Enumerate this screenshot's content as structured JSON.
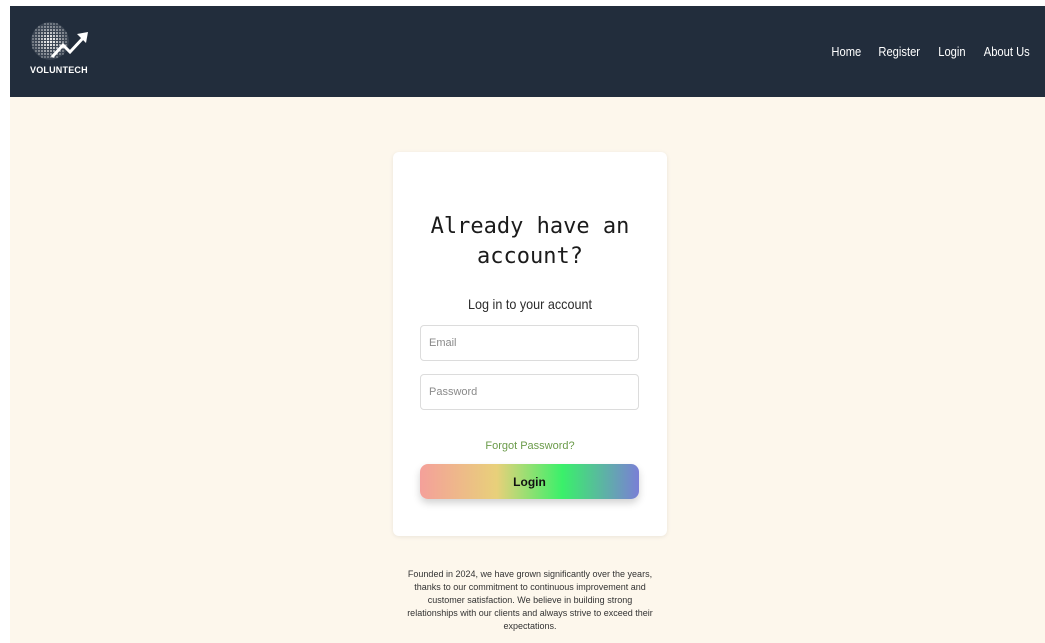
{
  "navbar": {
    "logo_text": "VOLUNTECH",
    "links": [
      {
        "label": "Home"
      },
      {
        "label": "Register"
      },
      {
        "label": "Login"
      },
      {
        "label": "About Us"
      }
    ]
  },
  "login_card": {
    "title": "Already have an account?",
    "subtitle": "Log in to your account",
    "email_placeholder": "Email",
    "password_placeholder": "Password",
    "forgot_label": "Forgot Password?",
    "login_label": "Login"
  },
  "footer": {
    "text": "Founded in 2024, we have grown significantly over the years, thanks to our commitment to continuous improvement and customer satisfaction. We believe in building strong relationships with our clients and always strive to exceed their expectations."
  },
  "colors": {
    "navbar_bg": "#222d3c",
    "page_bg": "#fdf7ec",
    "forgot_link": "#6b9b4a",
    "button_gradient": [
      "#f4a09a",
      "#e8d07a",
      "#3af06a",
      "#7a7fd6"
    ]
  },
  "icons": {
    "logo": "globe-growth-arrow-logo"
  }
}
